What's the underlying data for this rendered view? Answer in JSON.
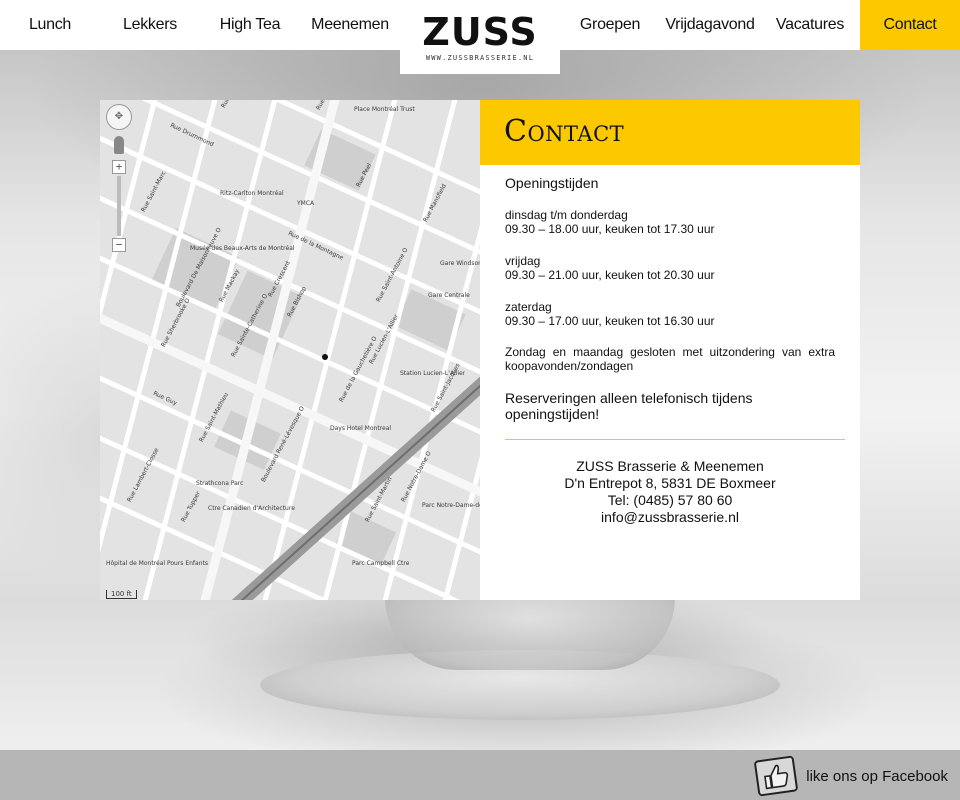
{
  "nav": {
    "left": [
      "Lunch",
      "Lekkers",
      "High Tea",
      "Meenemen"
    ],
    "right": [
      "Groepen",
      "Vrijdagavond",
      "Vacatures",
      "Contact"
    ],
    "active": "Contact",
    "accent": "#fcc900"
  },
  "logo": {
    "main": "ZUSS",
    "sub": "WWW.ZUSSBRASSERIE.NL"
  },
  "map": {
    "scale_label": "100 ft",
    "labels": [
      "Rue Sherbrooke O",
      "Rue Stanley",
      "Rue Drummond",
      "Rue Metcalfe",
      "Place Montréal Trust",
      "Boulevard De Maisonneuve O",
      "Rue Peel",
      "YMCA",
      "Rue Mackay",
      "Rue Bishop",
      "Rue Crescent",
      "Rue de la Montagne",
      "Rue Sainte-Catherine O",
      "Rue Guy",
      "Boulevard René-Lévesque O",
      "Rue Saint-Antoine O",
      "Parc Campbell Ctre",
      "Rue Notre-Dame O",
      "Rue Saint-Jacques",
      "Parc Notre-Dame-de-Grâce",
      "Rue Lucien-L'Allier",
      "Rue de la Gauchetière O",
      "Gare Centrale",
      "Station Lucien-L'Allier",
      "Rue Mansfield",
      "Gare Windsor",
      "Musée des Beaux-Arts de Montréal",
      "Ritz-Carlton Montréal",
      "Hôpital de Montréal Pours Enfants",
      "Strathcona Parc",
      "Ctre Canadien d'Architecture",
      "Days Hotel Montreal",
      "Rue Saint-Marc",
      "Rue Tupper",
      "Rue Lambert-Closse",
      "Rue Saint-Mathieu",
      "Rue Saint-Martin"
    ]
  },
  "contact": {
    "title": "Contact",
    "hours_title": "Openingstijden",
    "blocks": [
      {
        "day": "dinsdag t/m donderdag",
        "time": "09.30 – 18.00 uur, keuken tot 17.30 uur"
      },
      {
        "day": "vrijdag",
        "time": "09.30 – 21.00 uur, keuken tot 20.30 uur"
      },
      {
        "day": "zaterdag",
        "time": "09.30 – 17.00 uur, keuken tot 16.30 uur"
      }
    ],
    "closed": "Zondag en maandag gesloten met uitzondering van extra koopavonden/zondagen",
    "reserve": "Reserveringen alleen telefonisch tijdens openingstijden!",
    "address": {
      "name": "ZUSS Brasserie & Meenemen",
      "street": "D'n Entrepot 8, 5831 DE Boxmeer",
      "phone": "Tel: (0485) 57 80 60",
      "email": "info@zussbrasserie.nl"
    }
  },
  "footer": {
    "facebook_label": "like ons op Facebook"
  }
}
